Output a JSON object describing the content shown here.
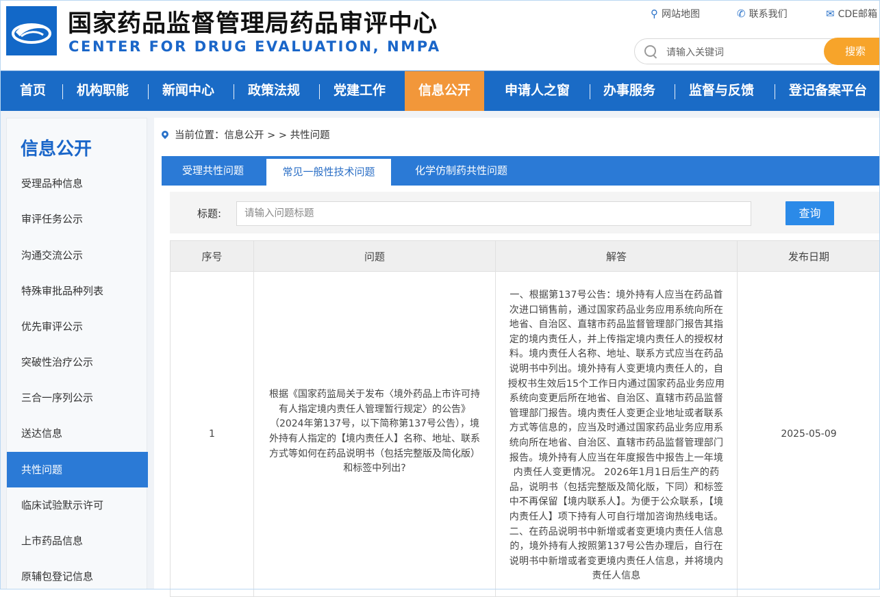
{
  "header": {
    "title_cn": "国家药品监督管理局药品审评中心",
    "title_en": "CENTER FOR DRUG EVALUATION, NMPA",
    "links": [
      {
        "label": "网站地图",
        "icon": "map-pin-icon"
      },
      {
        "label": "联系我们",
        "icon": "phone-icon"
      },
      {
        "label": "CDE邮箱",
        "icon": "mail-icon"
      }
    ],
    "search_placeholder": "请输入关键词",
    "search_button": "搜索"
  },
  "nav": {
    "items": [
      "首页",
      "机构职能",
      "新闻中心",
      "政策法规",
      "党建工作",
      "信息公开",
      "申请人之窗",
      "办事服务",
      "监督与反馈",
      "登记备案平台"
    ],
    "active": "信息公开"
  },
  "sidebar": {
    "title": "信息公开",
    "items": [
      "受理品种信息",
      "审评任务公示",
      "沟通交流公示",
      "特殊审批品种列表",
      "优先审评公示",
      "突破性治疗公示",
      "三合一序列公示",
      "送达信息",
      "共性问题",
      "临床试验默示许可",
      "上市药品信息",
      "原辅包登记信息"
    ],
    "active": "共性问题"
  },
  "breadcrumb": {
    "text": "当前位置：信息公开 > > 共性问题"
  },
  "tabs": {
    "items": [
      "受理共性问题",
      "常见一般性技术问题",
      "化学仿制药共性问题"
    ],
    "active": "常见一般性技术问题"
  },
  "filter": {
    "label": "标题:",
    "placeholder": "请输入问题标题",
    "button": "查询"
  },
  "table": {
    "columns": [
      "序号",
      "问题",
      "解答",
      "发布日期"
    ],
    "rows": [
      {
        "index": "1",
        "question": "根据《国家药监局关于发布〈境外药品上市许可持有人指定境内责任人管理暂行规定〉的公告》（2024年第137号，以下简称第137号公告），境外持有人指定的【境内责任人】名称、地址、联系方式等如何在药品说明书（包括完整版及简化版）和标签中列出?",
        "answer": "一、根据第137号公告：境外持有人应当在药品首次进口销售前，通过国家药品业务应用系统向所在地省、自治区、直辖市药品监督管理部门报告其指定的境内责任人，并上传指定境内责任人的授权材料。境内责任人名称、地址、联系方式应当在药品说明书中列出。境外持有人变更境内责任人的，自授权书生效后15个工作日内通过国家药品业务应用系统向变更后所在地省、自治区、直辖市药品监督管理部门报告。境内责任人变更企业地址或者联系方式等信息的，应当及时通过国家药品业务应用系统向所在地省、自治区、直辖市药品监督管理部门报告。境外持有人应当在年度报告中报告上一年境内责任人变更情况。 2026年1月1日后生产的药品，说明书（包括完整版及简化版，下同）和标签中不再保留【境内联系人】。为便于公众联系，【境内责任人】项下持有人可自行增加咨询热线电话。 二、在药品说明书中新增或者变更境内责任人信息的，境外持有人按照第137号公告办理后，自行在说明书中新增或者变更境内责任人信息，并将境内责任人信息",
        "date": "2025-05-09"
      }
    ]
  },
  "colors": {
    "brand_blue": "#1a6bc6",
    "accent_orange": "#f2973a",
    "search_orange": "#f7a42a",
    "button_blue": "#2b8ae8"
  }
}
